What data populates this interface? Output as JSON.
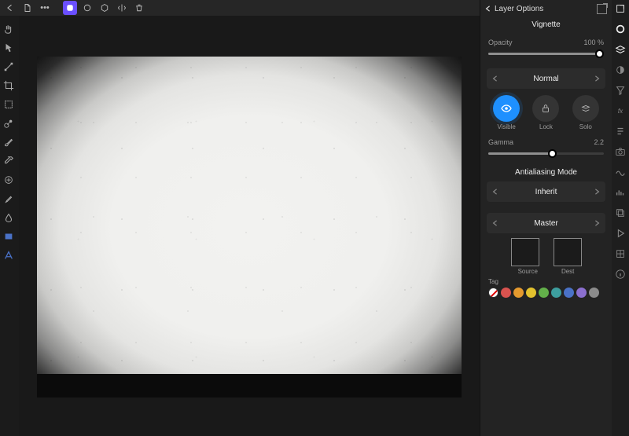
{
  "toolbar": {
    "items": [
      {
        "name": "back-arrow-icon",
        "glyph": "arrow-left"
      },
      {
        "name": "document-icon",
        "glyph": "doc"
      },
      {
        "name": "more-ellipsis",
        "glyph": "ellipsis"
      },
      {
        "name": "persona-icon",
        "glyph": "square-round",
        "active": true
      },
      {
        "name": "circle-icon",
        "glyph": "circle"
      },
      {
        "name": "hexagon-icon",
        "glyph": "hex"
      },
      {
        "name": "mirror-icon",
        "glyph": "mirror"
      },
      {
        "name": "trash-icon",
        "glyph": "trash"
      }
    ]
  },
  "leftTools": [
    "hand-icon",
    "pointer-icon",
    "node-icon",
    "crop-icon",
    "shape-icon",
    "gradient-icon",
    "brush-icon",
    "dropper-icon",
    "clone-icon",
    "retouch-icon",
    "smudge-icon",
    "rectangle-icon",
    "text-icon"
  ],
  "rightTools": [
    "popout-icon",
    "color-wheel-icon",
    "layers-icon",
    "adjust-icon",
    "funnel-icon",
    "fx-text",
    "text-style-icon",
    "camera-icon",
    "wave-icon",
    "histogram-icon",
    "stack-icon",
    "play-icon",
    "grid-icon",
    "info-icon"
  ],
  "panel": {
    "header": "Layer Options",
    "title": "Vignette",
    "opacity": {
      "label": "Opacity",
      "value_text": "100 %",
      "value": 100
    },
    "blendMode": "Normal",
    "visibility": {
      "options": [
        {
          "name": "visible-button",
          "label": "Visible",
          "icon": "eye",
          "active": true
        },
        {
          "name": "lock-button",
          "label": "Lock",
          "icon": "lock",
          "active": false
        },
        {
          "name": "solo-button",
          "label": "Solo",
          "icon": "stack",
          "active": false
        }
      ]
    },
    "gamma": {
      "label": "Gamma",
      "value_text": "2.2",
      "value": 2.2,
      "pct": 55
    },
    "antialias": {
      "title": "Antialiasing Mode",
      "value": "Inherit"
    },
    "master": {
      "title": "Master",
      "source": "Source",
      "dest": "Dest"
    },
    "tag": {
      "label": "Tag",
      "colors": [
        "none",
        "#d9534f",
        "#e59a2e",
        "#e3c22e",
        "#63b04a",
        "#3d9e9e",
        "#4a72c7",
        "#8b6fcf",
        "#8c8c8c"
      ]
    }
  }
}
